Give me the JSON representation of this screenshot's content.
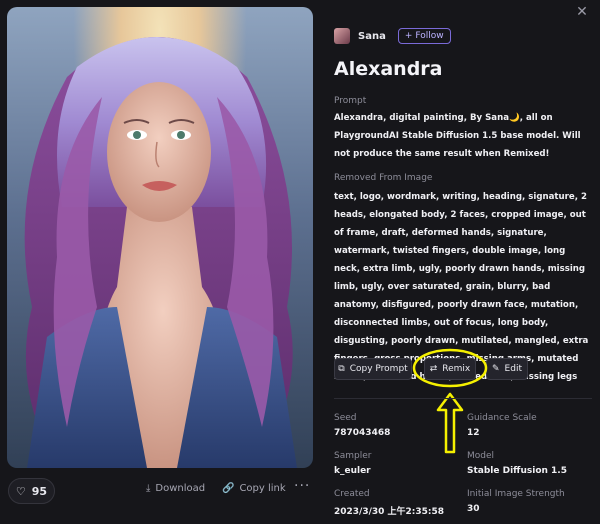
{
  "image": {
    "alt_icon": "portrait-image"
  },
  "bottom_bar": {
    "likes": "95",
    "download_label": "Download",
    "copy_link_label": "Copy link",
    "more_label": "···"
  },
  "header": {
    "username": "Sana",
    "follow_label": "Follow"
  },
  "title": "Alexandra",
  "prompt": {
    "label": "Prompt",
    "text": "Alexandra, digital painting, By Sana🌙, all on PlaygroundAI Stable Diffusion 1.5 base model. Will not produce the same result when Remixed!"
  },
  "negative": {
    "label": "Removed From Image",
    "text": "text, logo, wordmark, writing, heading, signature, 2 heads, elongated body, 2 faces, cropped image, out of frame, draft, deformed hands, signature, watermark, twisted fingers, double image, long neck, extra limb, ugly, poorly drawn hands, missing limb, ugly, over saturated, grain, blurry, bad anatomy, disfigured, poorly drawn face, mutation, disconnected limbs, out of focus, long body, disgusting, poorly drawn, mutilated, mangled, extra fingers, gross proportions, missing arms, mutated hands, mutilated hands, cloned face, missing legs"
  },
  "actions": {
    "copy_prompt": "Copy Prompt",
    "remix": "Remix",
    "edit": "Edit"
  },
  "meta": {
    "seed_label": "Seed",
    "seed": "787043468",
    "guidance_label": "Guidance Scale",
    "guidance": "12",
    "sampler_label": "Sampler",
    "sampler": "k_euler",
    "model_label": "Model",
    "model": "Stable Diffusion 1.5",
    "created_label": "Created",
    "created": "2023/3/30 上午2:35:58",
    "strength_label": "Initial Image Strength",
    "strength": "30"
  },
  "colors": {
    "background": "#16161a",
    "accent": "#7a6ad8",
    "annotation": "#f5f000"
  }
}
